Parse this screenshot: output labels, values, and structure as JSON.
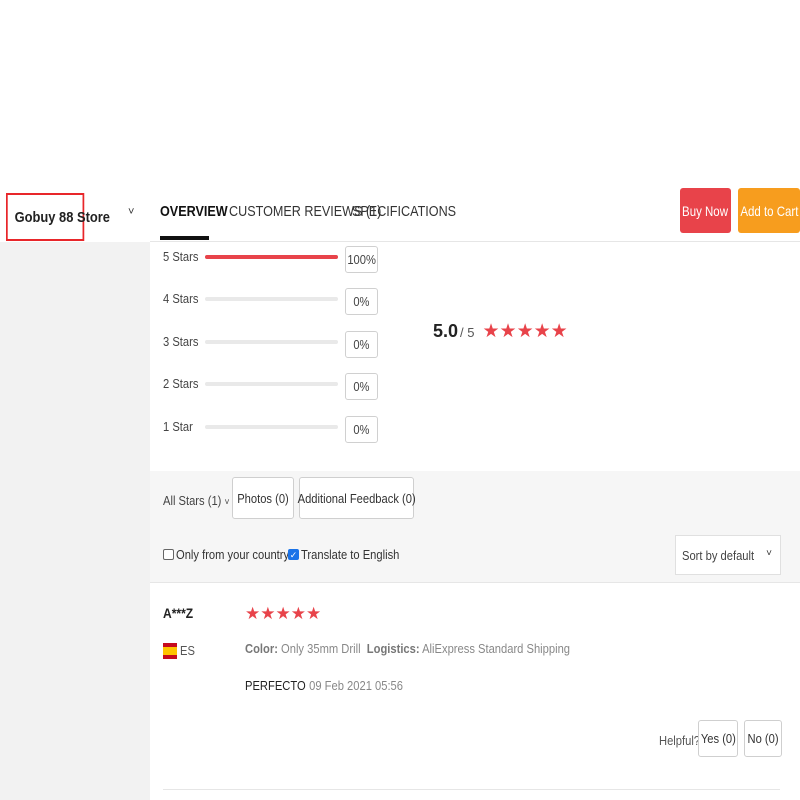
{
  "store": {
    "name": "Gobuy 88 Store"
  },
  "nav": {
    "tabs": [
      {
        "label": "OVERVIEW",
        "active": true
      },
      {
        "label": "CUSTOMER REVIEWS (1)",
        "active": false
      },
      {
        "label": "SPECIFICATIONS",
        "active": false
      }
    ],
    "buy_now": "Buy Now",
    "add_to_cart": "Add to Cart"
  },
  "histogram": [
    {
      "label": "5 Stars",
      "percent_text": "100%",
      "fraction": 1.0
    },
    {
      "label": "4 Stars",
      "percent_text": "0%",
      "fraction": 0
    },
    {
      "label": "3 Stars",
      "percent_text": "0%",
      "fraction": 0
    },
    {
      "label": "2 Stars",
      "percent_text": "0%",
      "fraction": 0
    },
    {
      "label": "1 Star",
      "percent_text": "0%",
      "fraction": 0
    }
  ],
  "rating": {
    "score": "5.0",
    "out_of": "/ 5",
    "stars": 5
  },
  "filters": {
    "all_stars": "All Stars (1)",
    "photos": "Photos (0)",
    "additional_feedback": "Additional Feedback (0)",
    "only_country": {
      "label": "Only from your country",
      "checked": false
    },
    "translate": {
      "label": "Translate to English",
      "checked": true
    },
    "sort": "Sort by default"
  },
  "review": {
    "reviewer": "A***Z",
    "country": "ES",
    "stars": 5,
    "color_label": "Color:",
    "color_value": "Only 35mm Drill",
    "logistics_label": "Logistics:",
    "logistics_value": "AliExpress Standard Shipping",
    "text": "PERFECTO",
    "date": "09 Feb 2021 05:56",
    "helpful": "Helpful?",
    "yes": "Yes (0)",
    "no": "No (0)"
  },
  "colors": {
    "accent_red": "#e8434a",
    "accent_orange": "#f79d1e",
    "highlight_border": "#e8262a"
  }
}
